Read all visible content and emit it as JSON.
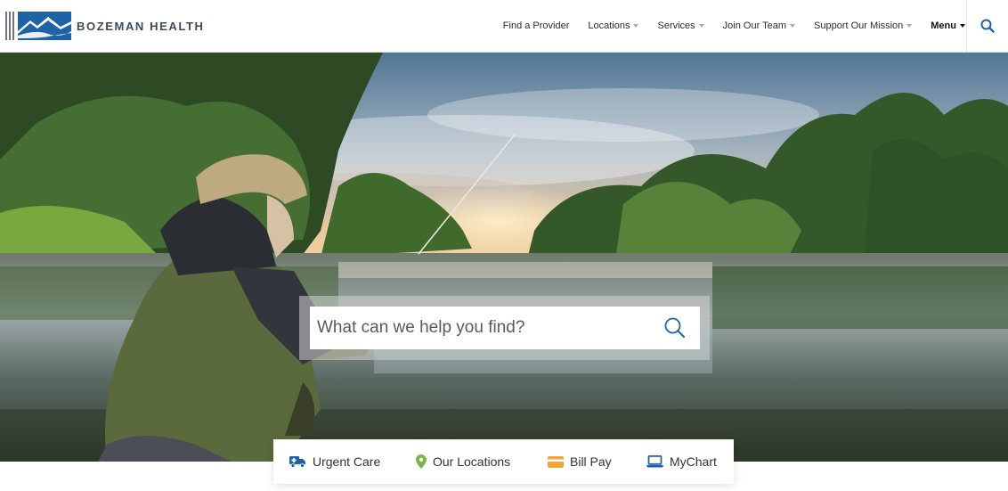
{
  "brand": {
    "name": "BOZEMAN HEALTH",
    "logo_color": "#1e63a6"
  },
  "nav": {
    "items": [
      {
        "label": "Find a Provider",
        "has_dropdown": false
      },
      {
        "label": "Locations",
        "has_dropdown": true
      },
      {
        "label": "Services",
        "has_dropdown": true
      },
      {
        "label": "Join Our Team",
        "has_dropdown": true
      },
      {
        "label": "Support Our Mission",
        "has_dropdown": true
      }
    ],
    "menu_label": "Menu",
    "search_icon": "search-icon",
    "accent": "#1e63a6"
  },
  "hero": {
    "image": "fisherman-river-scene",
    "search": {
      "placeholder": "What can we help you find?",
      "value": ""
    }
  },
  "quick_links": [
    {
      "label": "Urgent Care",
      "icon": "ambulance-icon",
      "color": "#1e63a6"
    },
    {
      "label": "Our Locations",
      "icon": "map-pin-icon",
      "color": "#7ab648"
    },
    {
      "label": "Bill Pay",
      "icon": "credit-card-icon",
      "color": "#f0a83a"
    },
    {
      "label": "MyChart",
      "icon": "laptop-icon",
      "color": "#1e63a6"
    }
  ]
}
